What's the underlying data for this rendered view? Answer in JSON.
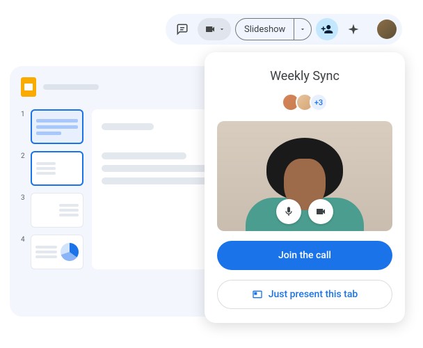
{
  "toolbar": {
    "slideshow_label": "Slideshow"
  },
  "filmstrip": {
    "nums": [
      "1",
      "2",
      "3",
      "4"
    ]
  },
  "meet": {
    "title": "Weekly Sync",
    "more_count": "+3",
    "join_label": "Join the call",
    "present_label": "Just present this tab"
  }
}
